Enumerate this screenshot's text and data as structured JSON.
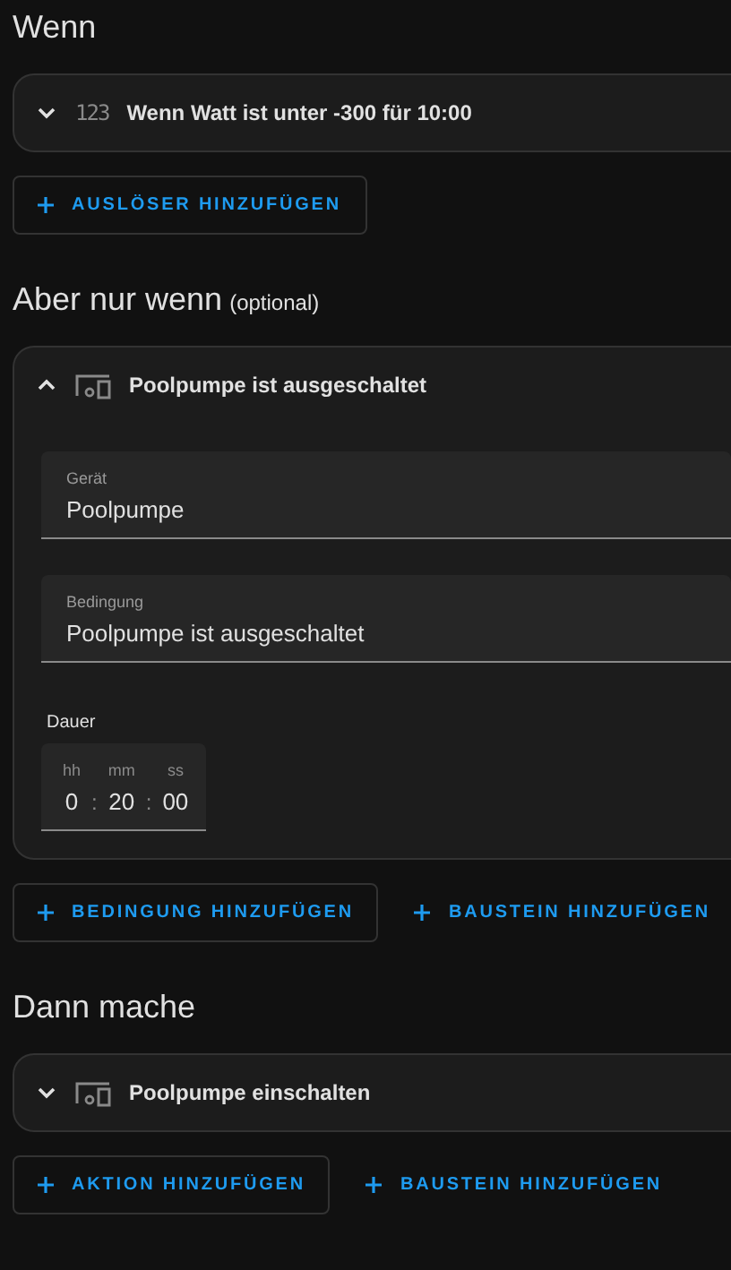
{
  "sections": [
    {
      "title": "Wenn",
      "items": [
        {
          "kind": "numeric",
          "icon_text": "123",
          "label": "Wenn Watt ist unter -300 für 10:00",
          "expanded": false
        }
      ],
      "buttons": [
        {
          "label": "AUSLÖSER HINZUFÜGEN",
          "outlined": true
        }
      ]
    },
    {
      "title": "Aber nur wenn",
      "subtitle": "(optional)",
      "items": [
        {
          "kind": "device",
          "label": "Poolpumpe ist ausgeschaltet",
          "expanded": true,
          "fields": [
            {
              "label": "Gerät",
              "value": "Poolpumpe"
            },
            {
              "label": "Bedingung",
              "value": "Poolpumpe ist ausgeschaltet"
            }
          ],
          "duration": {
            "label": "Dauer",
            "units": [
              {
                "label": "hh",
                "value": "0"
              },
              {
                "label": "mm",
                "value": "20"
              },
              {
                "label": "ss",
                "value": "00"
              }
            ],
            "separator": ":"
          }
        }
      ],
      "buttons": [
        {
          "label": "BEDINGUNG HINZUFÜGEN",
          "outlined": true
        },
        {
          "label": "BAUSTEIN HINZUFÜGEN",
          "outlined": false
        }
      ]
    },
    {
      "title": "Dann mache",
      "items": [
        {
          "kind": "device",
          "label": "Poolpumpe einschalten",
          "expanded": false
        }
      ],
      "buttons": [
        {
          "label": "AKTION HINZUFÜGEN",
          "outlined": true
        },
        {
          "label": "BAUSTEIN HINZUFÜGEN",
          "outlined": false
        }
      ]
    }
  ]
}
